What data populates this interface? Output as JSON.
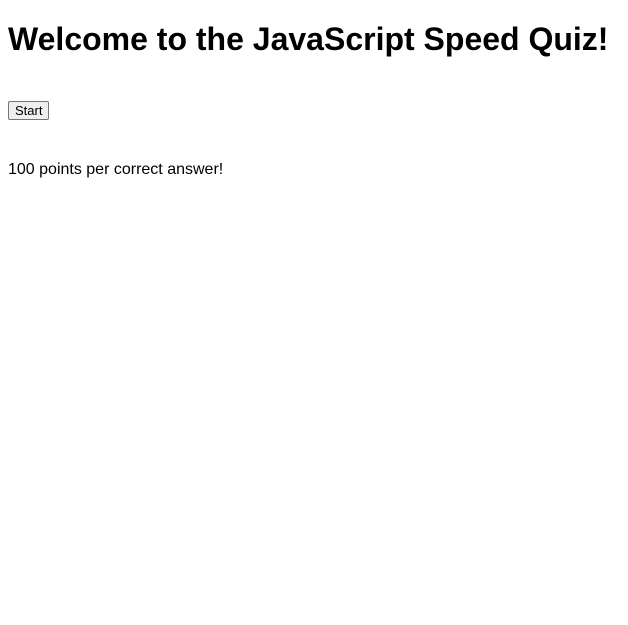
{
  "quiz": {
    "title": "Welcome to the JavaScript Speed Quiz!",
    "start_label": "Start",
    "points_info": "100 points per correct answer!"
  }
}
